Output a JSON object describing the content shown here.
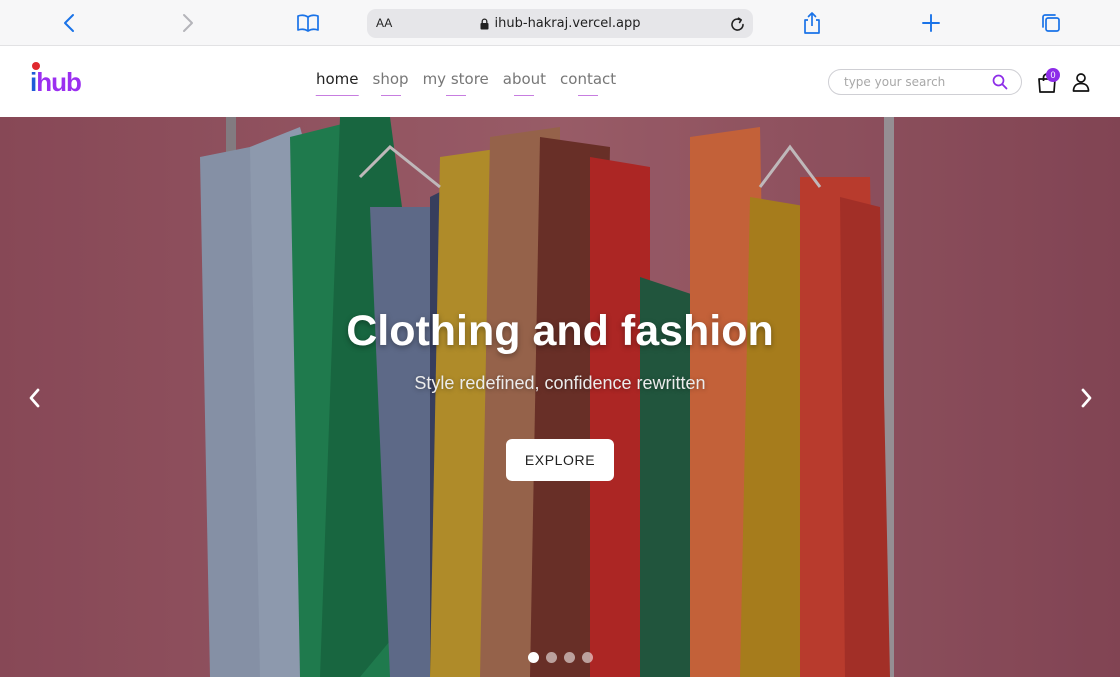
{
  "browser": {
    "aa_label": "AA",
    "url": "ihub-hakraj.vercel.app",
    "icons": {
      "back": "chevron-left-icon",
      "forward": "chevron-right-icon",
      "reader": "book-icon",
      "lock": "lock-icon",
      "reload": "reload-icon",
      "share": "share-icon",
      "new_tab": "plus-icon",
      "tabs": "tabs-icon"
    },
    "accent_color": "#1a73e8"
  },
  "header": {
    "logo": {
      "part1": "i",
      "part2": "hub",
      "color_primary": "#1f5bd8",
      "color_secondary": "#9b2ff0",
      "dot_color": "#e0282e"
    },
    "nav": [
      {
        "label": "home",
        "active": true
      },
      {
        "label": "shop",
        "active": false
      },
      {
        "label": "my store",
        "active": false
      },
      {
        "label": "about",
        "active": false
      },
      {
        "label": "contact",
        "active": false
      }
    ],
    "search": {
      "placeholder": "type your search",
      "value": "",
      "icon": "search-icon",
      "icon_color": "#8d2ce8"
    },
    "cart": {
      "count": "0",
      "icon": "shopping-bag-icon",
      "badge_color": "#8d2ce8"
    },
    "user": {
      "icon": "user-icon"
    }
  },
  "hero": {
    "title": "Clothing and fashion",
    "subtitle": "Style redefined, confidence rewritten",
    "button_label": "EXPLORE",
    "background_color": "#b06a78",
    "arrows": {
      "prev": "chevron-left-icon",
      "next": "chevron-right-icon"
    },
    "slides_total": 4,
    "active_slide": 1
  }
}
